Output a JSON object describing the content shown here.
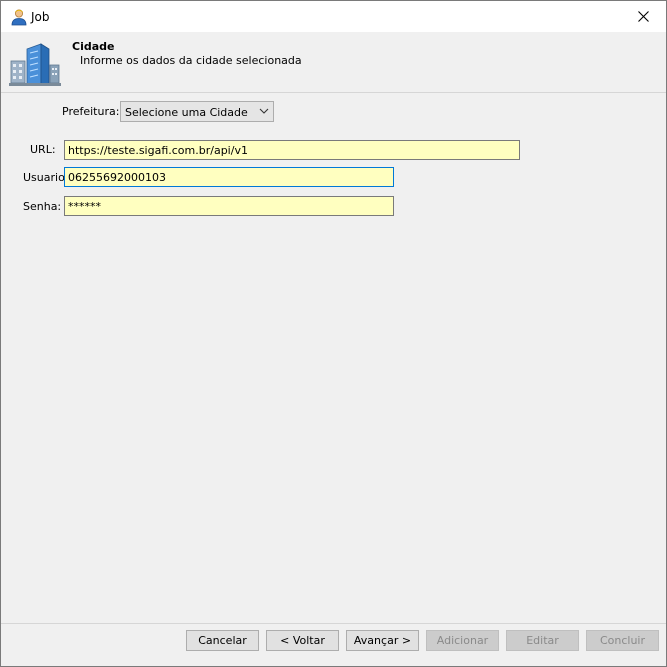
{
  "window": {
    "title": "Job"
  },
  "header": {
    "title": "Cidade",
    "subtitle": "Informe os dados da cidade selecionada"
  },
  "form": {
    "prefeitura_label": "Prefeitura:",
    "prefeitura_value": "Selecione uma Cidade",
    "url_label": "URL:",
    "url_value": "https://teste.sigafi.com.br/api/v1",
    "usuario_label": "Usuario:",
    "usuario_value": "06255692000103",
    "senha_label": "Senha:",
    "senha_value": "******"
  },
  "buttons": {
    "cancelar": "Cancelar",
    "voltar": "< Voltar",
    "avancar": "Avançar >",
    "adicionar": "Adicionar",
    "editar": "Editar",
    "concluir": "Concluir"
  },
  "colors": {
    "field_background": "#ffffc0",
    "focus_border": "#0078d7",
    "window_background": "#f0f0f0"
  },
  "icons": {
    "title": "user-icon",
    "header": "buildings-icon",
    "close": "close-icon",
    "dropdown": "chevron-down-icon"
  }
}
